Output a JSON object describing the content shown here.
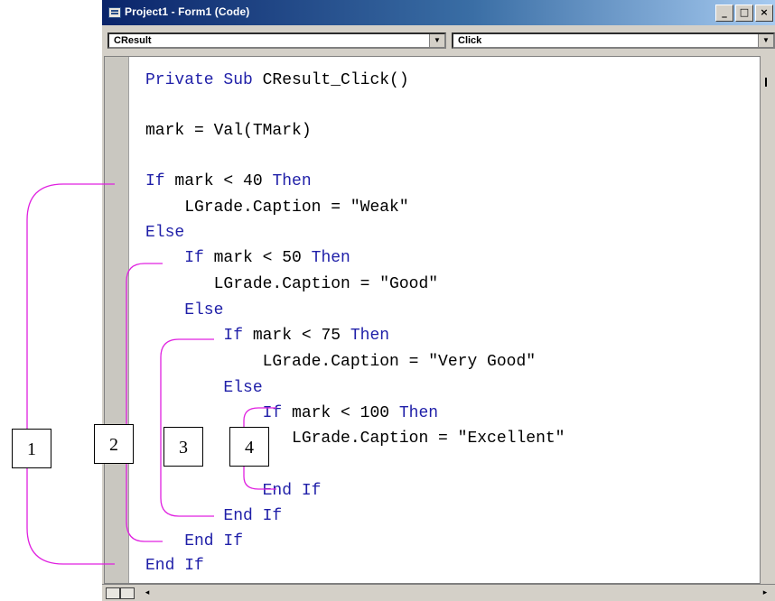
{
  "window": {
    "title": "Project1 - Form1 (Code)",
    "minimize_glyph": "_",
    "restore_glyph": "□",
    "close_glyph": "×"
  },
  "object_combo": {
    "selected": "CResult"
  },
  "procedure_combo": {
    "selected": "Click"
  },
  "code_lines": [
    {
      "parts": [
        {
          "t": "Private Sub ",
          "kw": true
        },
        {
          "t": "CResult_Click()",
          "kw": false
        }
      ]
    },
    {
      "parts": [
        {
          "t": "mark = Val(TMark)",
          "kw": false
        }
      ]
    },
    {
      "parts": [
        {
          "t": "If ",
          "kw": true
        },
        {
          "t": "mark < 40 ",
          "kw": false
        },
        {
          "t": "Then",
          "kw": true
        }
      ]
    },
    {
      "parts": [
        {
          "t": "    LGrade.Caption = \"Weak\"",
          "kw": false
        }
      ]
    },
    {
      "parts": [
        {
          "t": "Else",
          "kw": true
        }
      ]
    },
    {
      "parts": [
        {
          "t": "    If ",
          "kw": true
        },
        {
          "t": "mark < 50 ",
          "kw": false
        },
        {
          "t": "Then",
          "kw": true
        }
      ]
    },
    {
      "parts": [
        {
          "t": "       LGrade.Caption = \"Good\"",
          "kw": false
        }
      ]
    },
    {
      "parts": [
        {
          "t": "    Else",
          "kw": true
        }
      ]
    },
    {
      "parts": [
        {
          "t": "        If ",
          "kw": true
        },
        {
          "t": "mark < 75 ",
          "kw": false
        },
        {
          "t": "Then",
          "kw": true
        }
      ]
    },
    {
      "parts": [
        {
          "t": "            LGrade.Caption = \"Very Good\"",
          "kw": false
        }
      ]
    },
    {
      "parts": [
        {
          "t": "        Else",
          "kw": true
        }
      ]
    },
    {
      "parts": [
        {
          "t": "            If ",
          "kw": true
        },
        {
          "t": "mark < 100 ",
          "kw": false
        },
        {
          "t": "Then",
          "kw": true
        }
      ]
    },
    {
      "parts": [
        {
          "t": "               LGrade.Caption = \"Excellent\"",
          "kw": false
        }
      ]
    },
    {
      "parts": [
        {
          "t": "            End If",
          "kw": true
        }
      ]
    },
    {
      "parts": [
        {
          "t": "        End If",
          "kw": true
        }
      ]
    },
    {
      "parts": [
        {
          "t": "    End If",
          "kw": true
        }
      ]
    },
    {
      "parts": [
        {
          "t": "End If",
          "kw": true
        }
      ]
    }
  ],
  "annotation_labels": [
    "1",
    "2",
    "3",
    "4"
  ],
  "colors": {
    "keyword": "#1f1fa8",
    "bracket": "#e020e0",
    "titlebar": "#0a246a"
  },
  "scroll": {
    "left_arrow": "◂",
    "right_arrow": "▸",
    "combo_arrow": "▼"
  }
}
